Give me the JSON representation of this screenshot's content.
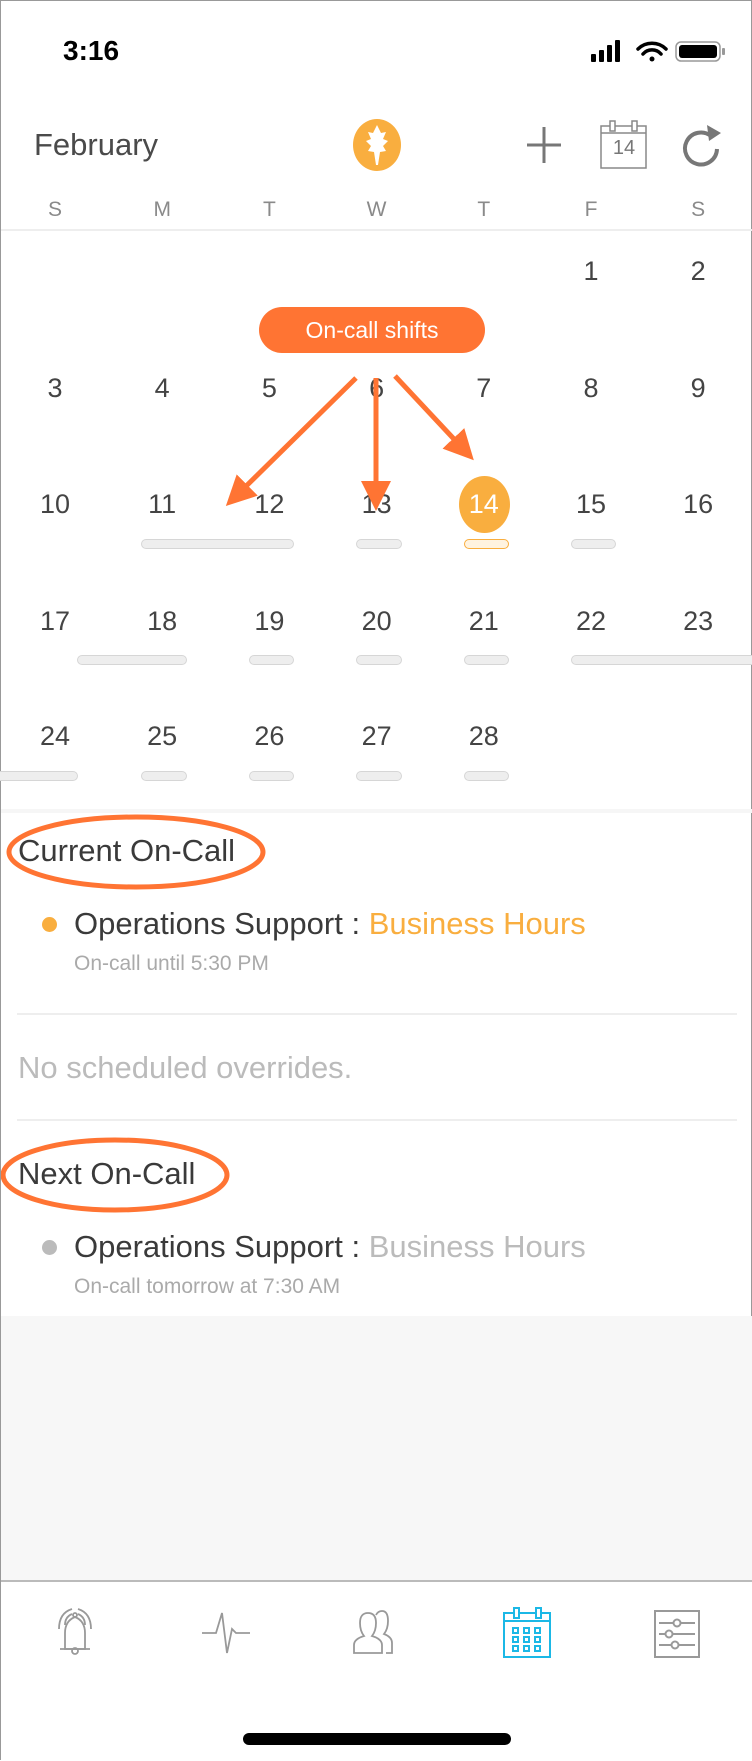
{
  "status_bar": {
    "time": "3:16"
  },
  "header": {
    "month": "February",
    "add_label": "+",
    "today_day": "14"
  },
  "weekdays": [
    "S",
    "M",
    "T",
    "W",
    "T",
    "F",
    "S"
  ],
  "calendar": {
    "weeks": [
      [
        null,
        null,
        null,
        null,
        null,
        1,
        2
      ],
      [
        3,
        4,
        5,
        6,
        7,
        8,
        9
      ],
      [
        10,
        11,
        12,
        13,
        14,
        15,
        16
      ],
      [
        17,
        18,
        19,
        20,
        21,
        22,
        23
      ],
      [
        24,
        25,
        26,
        27,
        28,
        null,
        null
      ]
    ],
    "today": 14
  },
  "annotation": {
    "label": "On-call shifts",
    "color": "#FF7433"
  },
  "current": {
    "title": "Current On-Call",
    "team": "Operations Support :",
    "schedule": "Business Hours",
    "detail": "On-call until 5:30 PM",
    "status_color": "#F9AE3F"
  },
  "overrides": {
    "text": "No scheduled overrides."
  },
  "next": {
    "title": "Next On-Call",
    "team": "Operations Support :",
    "schedule": "Business Hours",
    "detail": "On-call tomorrow at 7:30 AM",
    "status_color": "#BBBBBB"
  },
  "tabs": [
    {
      "icon": "alert-bell-icon",
      "active": false
    },
    {
      "icon": "pulse-icon",
      "active": false
    },
    {
      "icon": "people-icon",
      "active": false
    },
    {
      "icon": "calendar-icon",
      "active": true
    },
    {
      "icon": "settings-sliders-icon",
      "active": false
    }
  ],
  "colors": {
    "accent": "#F9AE3F",
    "active_tab": "#1BB8E6",
    "annotation": "#FF7433"
  }
}
